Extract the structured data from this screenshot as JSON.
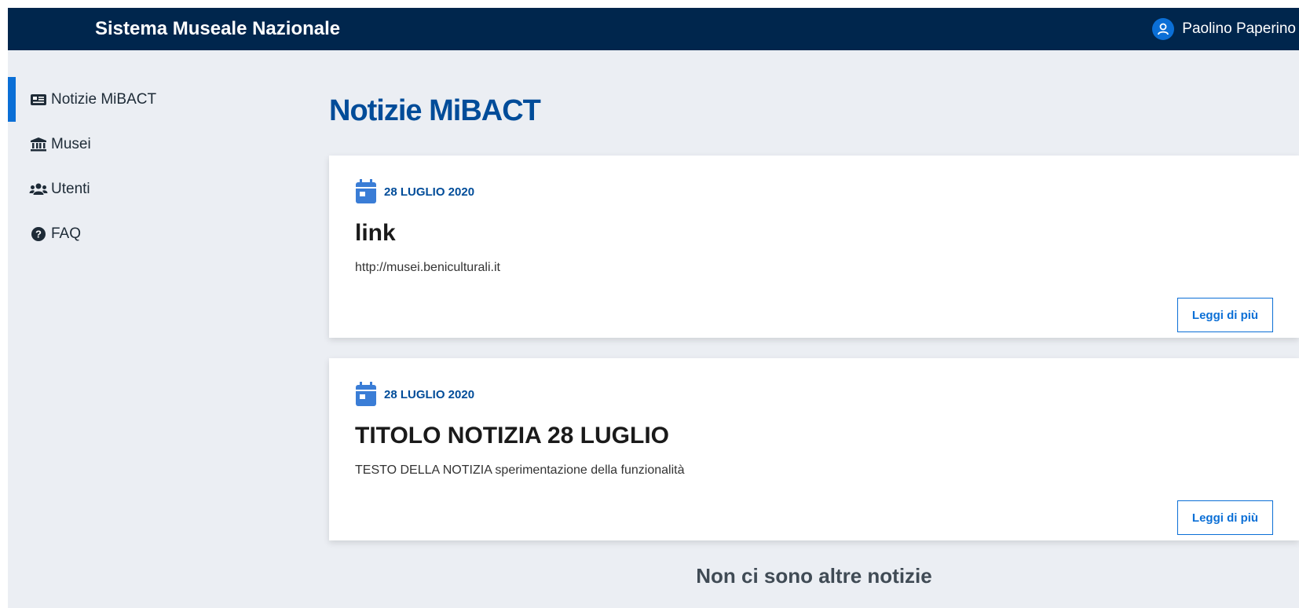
{
  "header": {
    "brand": "Sistema Museale Nazionale",
    "user_name": "Paolino Paperino",
    "user_icon": "user-circle-icon"
  },
  "sidebar": {
    "items": [
      {
        "label": "Notizie MiBACT",
        "icon": "newspaper-icon",
        "active": true
      },
      {
        "label": "Musei",
        "icon": "museum-icon",
        "active": false
      },
      {
        "label": "Utenti",
        "icon": "users-icon",
        "active": false
      },
      {
        "label": "FAQ",
        "icon": "question-circle-icon",
        "active": false
      }
    ]
  },
  "main": {
    "title": "Notizie MiBACT",
    "news": [
      {
        "date": "28 LUGLIO 2020",
        "title": "link",
        "text": "http://musei.beniculturali.it",
        "button": "Leggi di più"
      },
      {
        "date": "28 LUGLIO 2020",
        "title": "TITOLO NOTIZIA 28 LUGLIO",
        "text": "TESTO DELLA NOTIZIA sperimentazione della funzionalità",
        "button": "Leggi di più"
      }
    ],
    "end_message": "Non ci sono altre notizie"
  },
  "colors": {
    "topbar": "#00264d",
    "accent": "#0b6fd6",
    "title": "#004c99",
    "background": "#ebeef3"
  }
}
